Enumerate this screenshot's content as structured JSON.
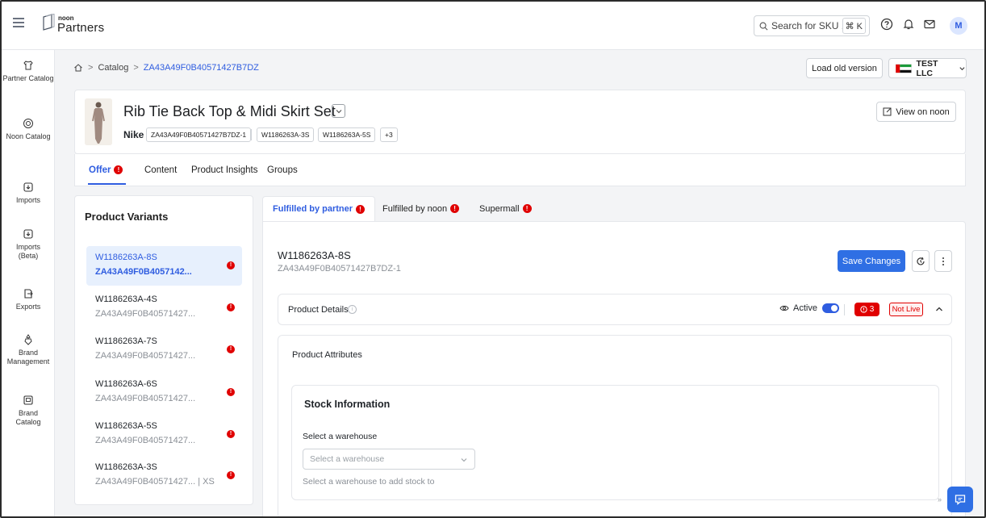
{
  "app": {
    "brand_small": "noon",
    "brand_big": "Partners"
  },
  "header": {
    "search_placeholder": "Search for SKU ...",
    "search_shortcut": "⌘ K",
    "avatar_initial": "M"
  },
  "rail": {
    "items": [
      {
        "label": "Partner Catalog",
        "icon": "shirt-icon"
      },
      {
        "label": "Noon Catalog",
        "icon": "noon-catalog-icon"
      },
      {
        "label": "Imports",
        "icon": "import-icon"
      },
      {
        "label": "Imports (Beta)",
        "icon": "import-beta-icon"
      },
      {
        "label": "Exports",
        "icon": "export-icon"
      },
      {
        "label": "Brand Management",
        "icon": "brand-management-icon"
      },
      {
        "label": "Brand Catalog",
        "icon": "brand-catalog-icon"
      }
    ]
  },
  "breadcrumb": {
    "catalog": "Catalog",
    "product_id": "ZA43A49F0B40571427B7DZ"
  },
  "actions": {
    "load_old_version": "Load old version",
    "company": "TEST LLC",
    "view_on_noon": "View on noon"
  },
  "product": {
    "title": "Rib Tie Back Top & Midi Skirt Set",
    "brand": "Nike",
    "chips": [
      "ZA43A49F0B40571427B7DZ-1",
      "W1186263A-3S",
      "W1186263A-5S",
      "+3"
    ]
  },
  "tabs": [
    {
      "label": "Offer",
      "badge": "!"
    },
    {
      "label": "Content"
    },
    {
      "label": "Product Insights"
    },
    {
      "label": "Groups"
    }
  ],
  "variants": {
    "title": "Product Variants",
    "items": [
      {
        "sku": "W1186263A-8S",
        "pid": "ZA43A49F0B4057142..."
      },
      {
        "sku": "W1186263A-4S",
        "pid": "ZA43A49F0B40571427..."
      },
      {
        "sku": "W1186263A-7S",
        "pid": "ZA43A49F0B40571427..."
      },
      {
        "sku": "W1186263A-6S",
        "pid": "ZA43A49F0B40571427..."
      },
      {
        "sku": "W1186263A-5S",
        "pid": "ZA43A49F0B40571427..."
      },
      {
        "sku": "W1186263A-3S",
        "pid": "ZA43A49F0B40571427...  |  XS"
      }
    ]
  },
  "fulfillment_tabs": [
    {
      "label": "Fulfilled by partner"
    },
    {
      "label": "Fulfilled by noon"
    },
    {
      "label": "Supermall"
    }
  ],
  "main": {
    "sku": "W1186263A-8S",
    "pid": "ZA43A49F0B40571427B7DZ-1",
    "save_label": "Save Changes",
    "product_details_label": "Product Details",
    "active_label": "Active",
    "error_count": "3",
    "not_live_label": "Not Live",
    "attributes_title": "Product Attributes",
    "stock_title": "Stock Information",
    "warehouse_label": "Select a warehouse",
    "warehouse_placeholder": "Select a warehouse",
    "warehouse_help": "Select a warehouse to add stock to"
  },
  "colors": {
    "accent": "#2f5de0",
    "error": "#e00000",
    "primary_button": "#2f6fe4"
  }
}
